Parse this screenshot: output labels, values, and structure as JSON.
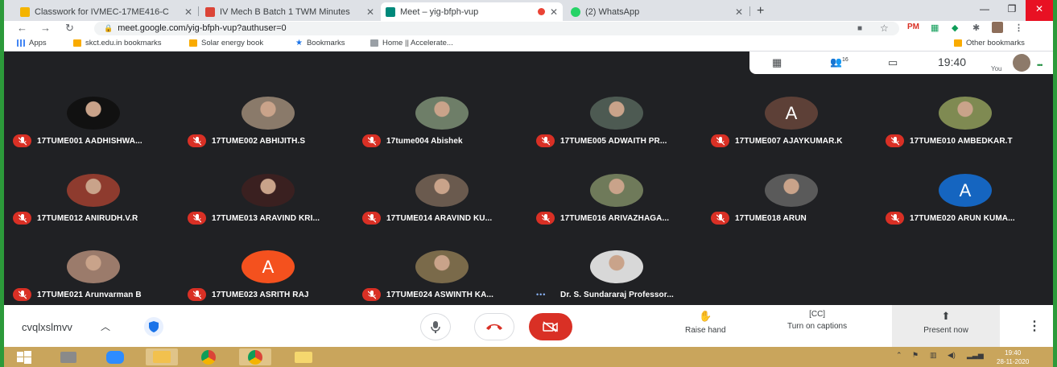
{
  "browser": {
    "tabs": [
      {
        "title": "Classwork for IVMEC-17ME416-C",
        "favicon_color": "#f4b400",
        "active": false
      },
      {
        "title": "IV Mech B Batch 1 TWM Minutes",
        "favicon_color": "#db4437",
        "active": false
      },
      {
        "title": "Meet – yig-bfph-vup",
        "favicon_color": "#00897b",
        "active": true
      },
      {
        "title": "(2) WhatsApp",
        "favicon_color": "#25d366",
        "active": false
      }
    ],
    "url": "meet.google.com/yig-bfph-vup?authuser=0",
    "bookmarks": [
      {
        "label": "Apps",
        "icon": "apps-grid-icon"
      },
      {
        "label": "skct.edu.in bookmarks",
        "icon": "folder-icon"
      },
      {
        "label": "Solar energy book",
        "icon": "folder-icon"
      },
      {
        "label": "Bookmarks",
        "icon": "star-icon"
      },
      {
        "label": "Home || Accelerate...",
        "icon": "page-icon"
      }
    ],
    "other_bookmarks": "Other bookmarks",
    "extensions": [
      "PM"
    ]
  },
  "meeting": {
    "participant_count": "16",
    "time": "19:40",
    "you_label": "You",
    "participants": [
      {
        "name": "17TUME001 AADHISHWA...",
        "avatar": "photo",
        "color": "#111111"
      },
      {
        "name": "17TUME002 ABHIJITH.S",
        "avatar": "photo",
        "color": "#8a7a6a"
      },
      {
        "name": "17tume004 Abishek",
        "avatar": "photo",
        "color": "#6e7e68"
      },
      {
        "name": "17TUME005 ADWAITH PR...",
        "avatar": "photo",
        "color": "#4d5a52"
      },
      {
        "name": "17TUME007 AJAYKUMAR.K",
        "avatar": "letter",
        "letter": "A",
        "color": "#5d4037"
      },
      {
        "name": "17TUME010 AMBEDKAR.T",
        "avatar": "photo",
        "color": "#7f8a52"
      },
      {
        "name": "17TUME012 ANIRUDH.V.R",
        "avatar": "photo",
        "color": "#8e3b2e"
      },
      {
        "name": "17TUME013 ARAVIND KRI...",
        "avatar": "photo",
        "color": "#3a2020"
      },
      {
        "name": "17TUME014 ARAVIND KU...",
        "avatar": "photo",
        "color": "#6a5a4e"
      },
      {
        "name": "17TUME016 ARIVAZHAGA...",
        "avatar": "photo",
        "color": "#6f7a5a"
      },
      {
        "name": "17TUME018 ARUN",
        "avatar": "photo",
        "color": "#5a5a5a"
      },
      {
        "name": "17TUME020 ARUN KUMA...",
        "avatar": "letter",
        "letter": "A",
        "color": "#1565c0"
      },
      {
        "name": "17TUME021 Arunvarman B",
        "avatar": "photo",
        "color": "#9b7b6b"
      },
      {
        "name": "17TUME023 ASRITH RAJ",
        "avatar": "letter",
        "letter": "A",
        "color": "#f4511e"
      },
      {
        "name": "17TUME024 ASWINTH KA...",
        "avatar": "photo",
        "color": "#7a6a4a"
      },
      {
        "name": "Dr. S. Sundararaj Professor...",
        "avatar": "photo",
        "color": "#d8d8d8",
        "speaking": true
      }
    ],
    "code": "cvqlxslmvv",
    "raise_hand": "Raise hand",
    "captions": "Turn on captions",
    "present": "Present now"
  },
  "taskbar": {
    "time": "19:40",
    "date": "28-11-2020"
  }
}
